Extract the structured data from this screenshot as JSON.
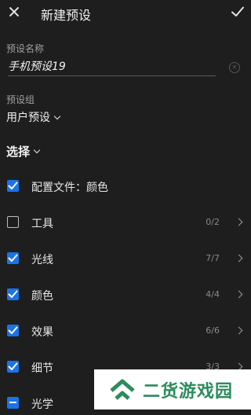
{
  "header": {
    "title": "新建预设",
    "close_icon": "close-icon",
    "confirm_icon": "check-icon"
  },
  "preset_name": {
    "label": "预设名称",
    "value": "手机预设19"
  },
  "preset_group": {
    "label": "预设组",
    "value": "用户预设"
  },
  "select_menu": {
    "label": "选择"
  },
  "items": [
    {
      "label": "配置文件：颜色",
      "state": "checked",
      "count": "",
      "arrow": false
    },
    {
      "label": "工具",
      "state": "unchecked",
      "count": "0/2",
      "arrow": true
    },
    {
      "label": "光线",
      "state": "checked",
      "count": "7/7",
      "arrow": true
    },
    {
      "label": "颜色",
      "state": "checked",
      "count": "4/4",
      "arrow": true
    },
    {
      "label": "效果",
      "state": "checked",
      "count": "6/6",
      "arrow": true
    },
    {
      "label": "细节",
      "state": "checked",
      "count": "3/3",
      "arrow": true
    },
    {
      "label": "光学",
      "state": "partial",
      "count": "",
      "arrow": false
    }
  ],
  "watermark": {
    "text": "二货游戏园"
  },
  "colors": {
    "accent": "#1a73e8",
    "background": "#1e1e1e",
    "watermark_green": "#2c8c5c"
  }
}
